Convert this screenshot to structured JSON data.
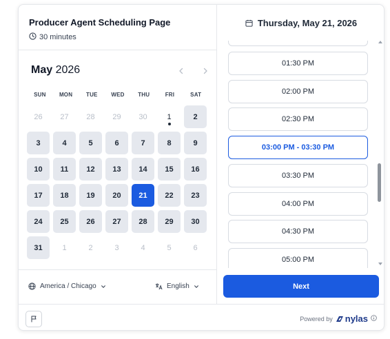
{
  "event": {
    "title": "Producer Agent Scheduling Page",
    "duration": "30 minutes"
  },
  "calendar": {
    "month": "May",
    "year": "2026",
    "weekdays": [
      "SUN",
      "MON",
      "TUE",
      "WED",
      "THU",
      "FRI",
      "SAT"
    ],
    "days": [
      {
        "label": "26",
        "state": "muted"
      },
      {
        "label": "27",
        "state": "muted"
      },
      {
        "label": "28",
        "state": "muted"
      },
      {
        "label": "29",
        "state": "muted"
      },
      {
        "label": "30",
        "state": "muted"
      },
      {
        "label": "1",
        "state": "today"
      },
      {
        "label": "2",
        "state": "avail"
      },
      {
        "label": "3",
        "state": "avail"
      },
      {
        "label": "4",
        "state": "avail"
      },
      {
        "label": "5",
        "state": "avail"
      },
      {
        "label": "6",
        "state": "avail"
      },
      {
        "label": "7",
        "state": "avail"
      },
      {
        "label": "8",
        "state": "avail"
      },
      {
        "label": "9",
        "state": "avail"
      },
      {
        "label": "10",
        "state": "avail"
      },
      {
        "label": "11",
        "state": "avail"
      },
      {
        "label": "12",
        "state": "avail"
      },
      {
        "label": "13",
        "state": "avail"
      },
      {
        "label": "14",
        "state": "avail"
      },
      {
        "label": "15",
        "state": "avail"
      },
      {
        "label": "16",
        "state": "avail"
      },
      {
        "label": "17",
        "state": "avail"
      },
      {
        "label": "18",
        "state": "avail"
      },
      {
        "label": "19",
        "state": "avail"
      },
      {
        "label": "20",
        "state": "avail"
      },
      {
        "label": "21",
        "state": "selected"
      },
      {
        "label": "22",
        "state": "avail"
      },
      {
        "label": "23",
        "state": "avail"
      },
      {
        "label": "24",
        "state": "avail"
      },
      {
        "label": "25",
        "state": "avail"
      },
      {
        "label": "26",
        "state": "avail"
      },
      {
        "label": "27",
        "state": "avail"
      },
      {
        "label": "28",
        "state": "avail"
      },
      {
        "label": "29",
        "state": "avail"
      },
      {
        "label": "30",
        "state": "avail"
      },
      {
        "label": "31",
        "state": "avail"
      },
      {
        "label": "1",
        "state": "muted"
      },
      {
        "label": "2",
        "state": "muted"
      },
      {
        "label": "3",
        "state": "muted"
      },
      {
        "label": "4",
        "state": "muted"
      },
      {
        "label": "5",
        "state": "muted"
      },
      {
        "label": "6",
        "state": "muted"
      }
    ]
  },
  "footer": {
    "timezone": "America / Chicago",
    "language": "English"
  },
  "schedule": {
    "selected_date": "Thursday, May 21, 2026",
    "slots": [
      {
        "label": "",
        "active": false
      },
      {
        "label": "01:30 PM",
        "active": false
      },
      {
        "label": "02:00 PM",
        "active": false
      },
      {
        "label": "02:30 PM",
        "active": false
      },
      {
        "label": "03:00 PM - 03:30 PM",
        "active": true
      },
      {
        "label": "03:30 PM",
        "active": false
      },
      {
        "label": "04:00 PM",
        "active": false
      },
      {
        "label": "04:30 PM",
        "active": false
      },
      {
        "label": "05:00 PM",
        "active": false
      }
    ],
    "next_label": "Next"
  },
  "branding": {
    "powered_by": "Powered by",
    "brand_name": "nylas"
  },
  "colors": {
    "accent": "#1b5be0",
    "available_day": "#e5e8ee",
    "border": "#e5e7eb"
  }
}
